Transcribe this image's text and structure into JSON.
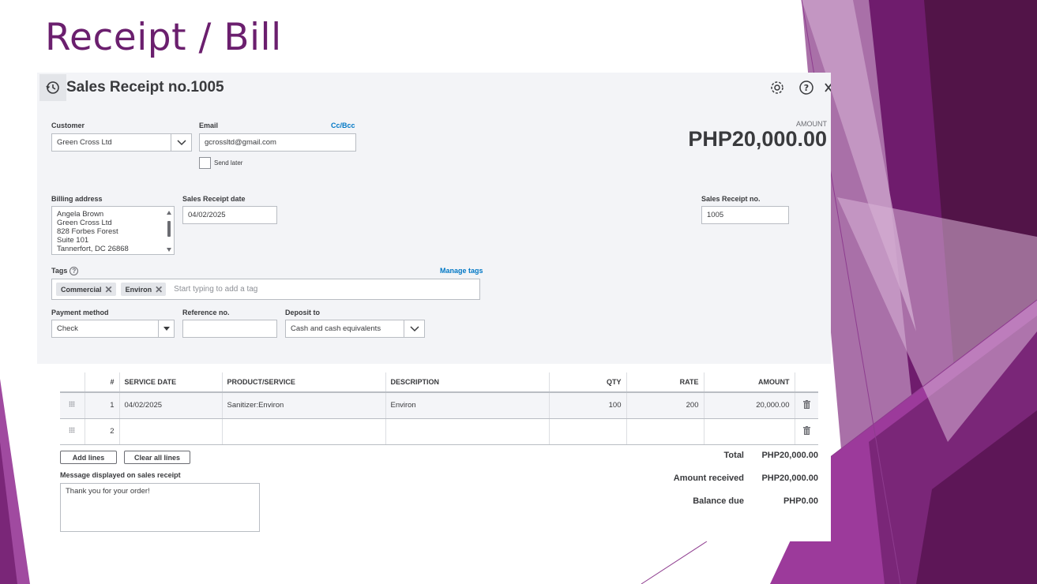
{
  "slide": {
    "title": "Receipt / Bill"
  },
  "header": {
    "title": "Sales Receipt no.1005",
    "settings_icon": "gear-icon",
    "help_icon": "question-icon",
    "close_icon": "close-icon"
  },
  "customer": {
    "label": "Customer",
    "value": "Green Cross Ltd"
  },
  "email": {
    "label": "Email",
    "value": "gcrossltd@gmail.com",
    "cc_link": "Cc/Bcc",
    "send_later": "Send later"
  },
  "amount": {
    "label": "AMOUNT",
    "value": "PHP20,000.00"
  },
  "billing": {
    "label": "Billing address",
    "lines": [
      "Angela Brown",
      "Green Cross Ltd",
      "828 Forbes Forest",
      "Suite 101",
      "Tannerfort, DC  26868"
    ]
  },
  "receipt_date": {
    "label": "Sales Receipt date",
    "value": "04/02/2025"
  },
  "receipt_no": {
    "label": "Sales Receipt no.",
    "value": "1005"
  },
  "tags": {
    "label": "Tags",
    "manage": "Manage tags",
    "chips": [
      "Commercial",
      "Environ"
    ],
    "placeholder": "Start typing to add a tag"
  },
  "payment_method": {
    "label": "Payment method",
    "value": "Check"
  },
  "reference": {
    "label": "Reference no.",
    "value": ""
  },
  "deposit_to": {
    "label": "Deposit to",
    "value": "Cash and cash equivalents"
  },
  "table": {
    "headers": [
      "#",
      "SERVICE DATE",
      "PRODUCT/SERVICE",
      "DESCRIPTION",
      "QTY",
      "RATE",
      "AMOUNT"
    ],
    "rows": [
      {
        "num": "1",
        "date": "04/02/2025",
        "product": "Sanitizer:Environ",
        "description": "Environ",
        "qty": "100",
        "rate": "200",
        "amount": "20,000.00"
      },
      {
        "num": "2",
        "date": "",
        "product": "",
        "description": "",
        "qty": "",
        "rate": "",
        "amount": ""
      }
    ]
  },
  "buttons": {
    "add_lines": "Add lines",
    "clear_lines": "Clear all lines"
  },
  "message": {
    "label": "Message displayed on sales receipt",
    "value": "Thank you for your order!"
  },
  "totals": {
    "total_label": "Total",
    "total_value": "PHP20,000.00",
    "received_label": "Amount received",
    "received_value": "PHP20,000.00",
    "balance_label": "Balance due",
    "balance_value": "PHP0.00"
  },
  "colors": {
    "title_purple": "#6b1f6e",
    "link_blue": "#0077c5",
    "header_bg": "#f3f4f7"
  }
}
